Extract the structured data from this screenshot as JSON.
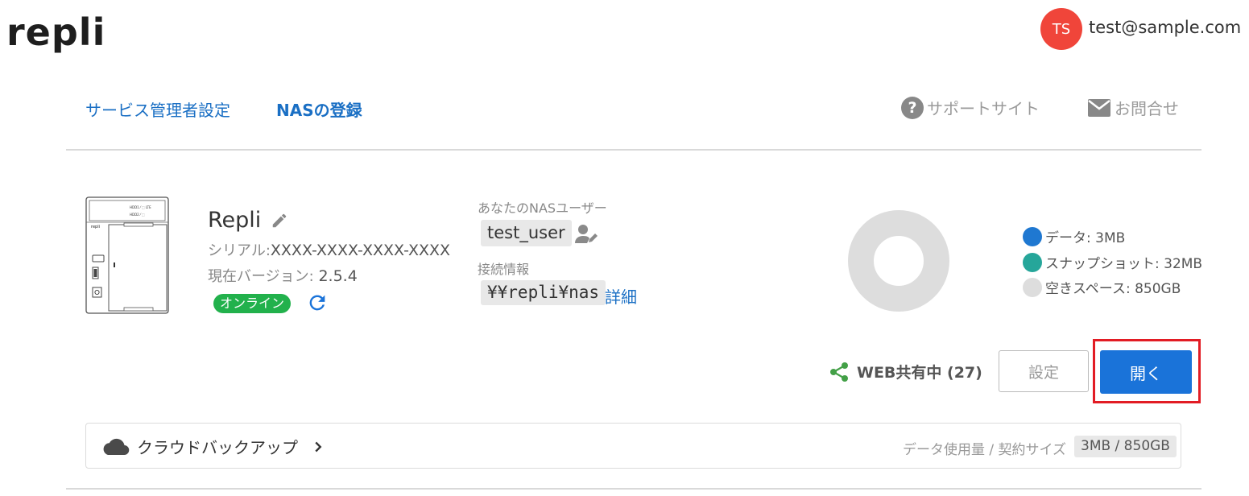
{
  "header": {
    "logo": "repli",
    "avatar_initials": "TS",
    "user_email": "test@sample.com"
  },
  "nav": {
    "admin_settings": "サービス管理者設定",
    "nas_register": "NASの登録",
    "support_site": "サポートサイト",
    "contact": "お問合せ"
  },
  "device": {
    "name": "Repli",
    "serial_label": "シリアル:",
    "serial_value": "XXXX-XXXX-XXXX-XXXX",
    "version_label": "現在バージョン: ",
    "version_value": "2.5.4",
    "status": "オンライン",
    "nas_user_label": "あなたのNASユーザー",
    "nas_user": "test_user",
    "connection_label": "接続情報",
    "connection_path": "¥¥repli¥nas",
    "connection_detail": "詳細"
  },
  "storage": {
    "legend": [
      {
        "label": "データ: 3MB",
        "color": "#1f78d1"
      },
      {
        "label": "スナップショット: 32MB",
        "color": "#26a69a"
      },
      {
        "label": "空きスペース: 850GB",
        "color": "#dddddd"
      }
    ]
  },
  "actions": {
    "web_share": "WEB共有中 (27)",
    "settings": "設定",
    "open": "開く"
  },
  "cloud_backup": {
    "title": "クラウドバックアップ",
    "usage_label": "データ使用量 / 契約サイズ",
    "usage_value": "3MB / 850GB"
  },
  "colors": {
    "accent": "#1a73d9",
    "link": "#1a6fc4",
    "online": "#22b14c",
    "avatar": "#f0453a",
    "highlight": "#e21c24"
  }
}
